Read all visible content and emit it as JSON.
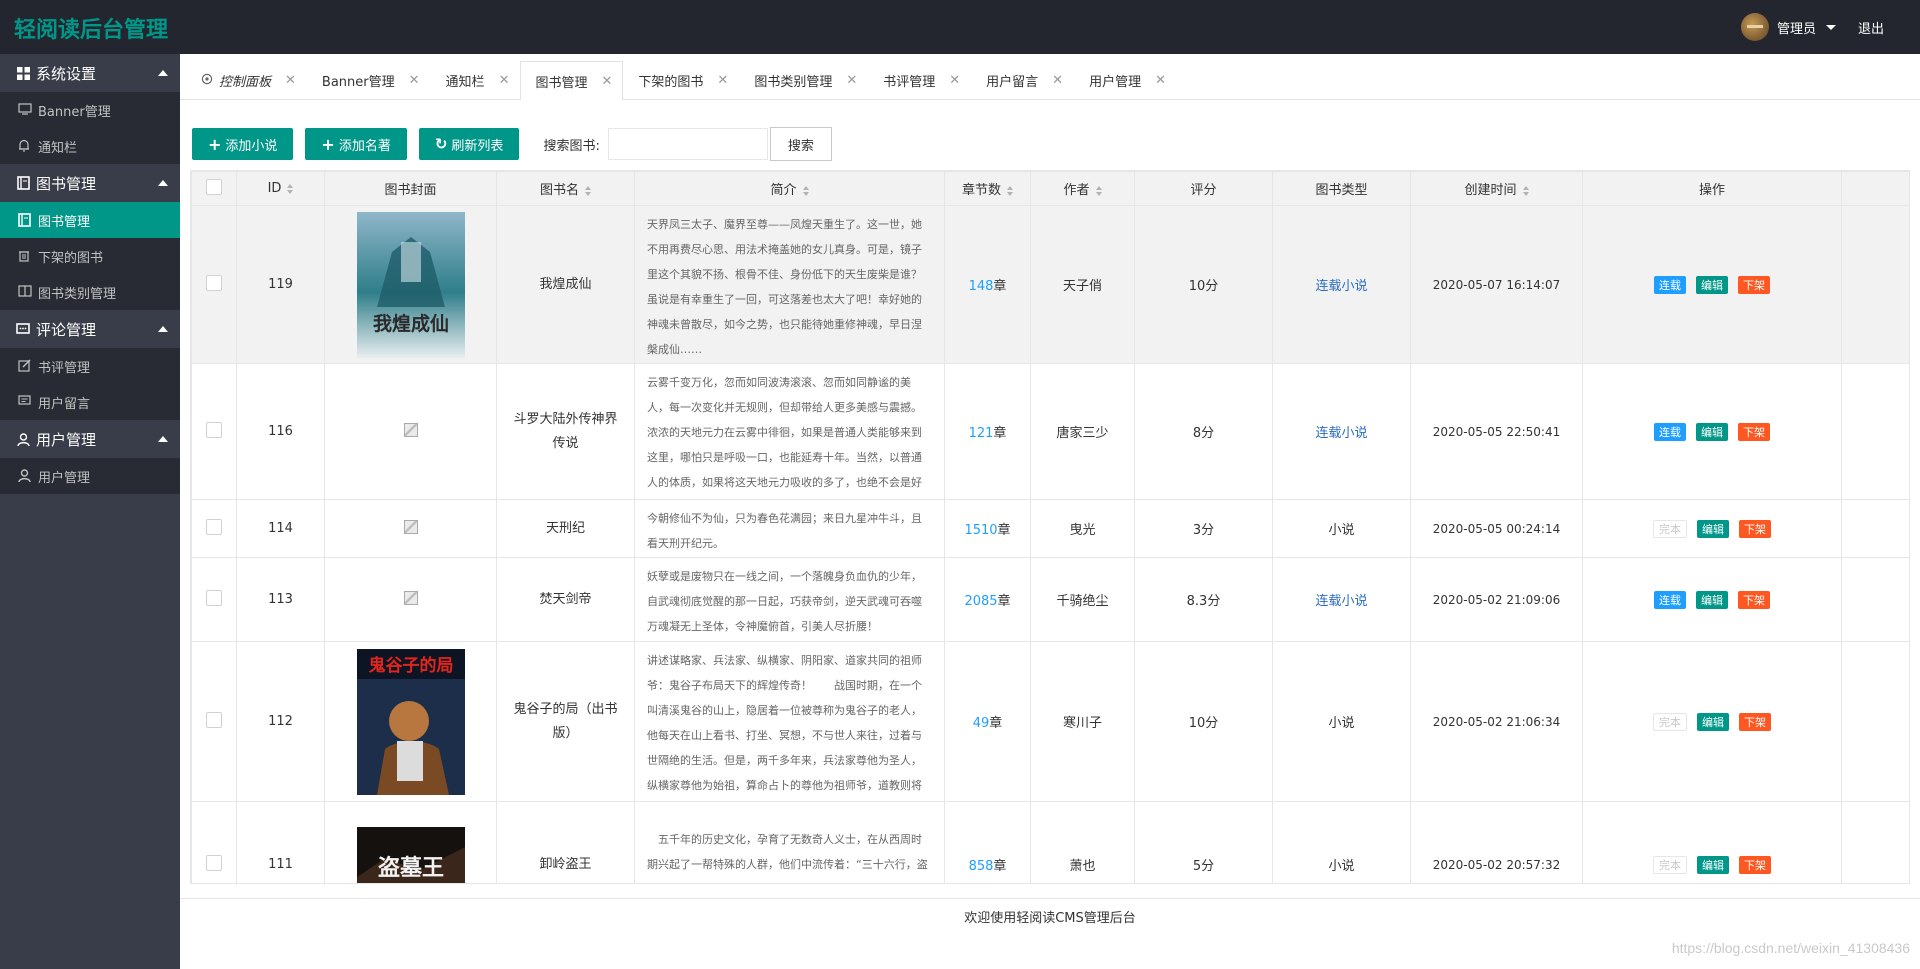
{
  "header": {
    "logo": "轻阅读后台管理",
    "user": "管理员",
    "logout": "退出"
  },
  "sidebar": [
    {
      "title": "系统设置",
      "icon": "grid-icon",
      "items": [
        {
          "label": "Banner管理",
          "icon": "monitor-icon"
        },
        {
          "label": "通知栏",
          "icon": "bell-icon"
        }
      ]
    },
    {
      "title": "图书管理",
      "icon": "book-icon",
      "items": [
        {
          "label": "图书管理",
          "icon": "book-icon",
          "active": true
        },
        {
          "label": "下架的图书",
          "icon": "trash-icon"
        },
        {
          "label": "图书类别管理",
          "icon": "open-book-icon"
        }
      ]
    },
    {
      "title": "评论管理",
      "icon": "comment-icon",
      "items": [
        {
          "label": "书评管理",
          "icon": "edit-icon"
        },
        {
          "label": "用户留言",
          "icon": "message-icon"
        }
      ]
    },
    {
      "title": "用户管理",
      "icon": "user-icon",
      "items": [
        {
          "label": "用户管理",
          "icon": "user-icon"
        }
      ]
    }
  ],
  "tabs": [
    {
      "label": "控制面板",
      "home": true
    },
    {
      "label": "Banner管理"
    },
    {
      "label": "通知栏"
    },
    {
      "label": "图书管理",
      "active": true
    },
    {
      "label": "下架的图书"
    },
    {
      "label": "图书类别管理"
    },
    {
      "label": "书评管理"
    },
    {
      "label": "用户留言"
    },
    {
      "label": "用户管理"
    }
  ],
  "toolbar": {
    "add_novel": "添加小说",
    "add_classic": "添加名著",
    "refresh": "刷新列表",
    "search_label": "搜索图书:",
    "search_value": "",
    "search_button": "搜索"
  },
  "table": {
    "columns": [
      "",
      "ID",
      "图书封面",
      "图书名",
      "简介",
      "章节数",
      "作者",
      "评分",
      "图书类型",
      "创建时间",
      "操作"
    ],
    "rows": [
      {
        "id": "119",
        "cover": "image",
        "cover_title": "我煌成仙",
        "name": "我煌成仙",
        "desc": "天界凤三太子、魔界至尊——凤煌天重生了。这一世，她不用再费尽心思、用法术掩盖她的女儿真身。可是，镜子里这个其貌不扬、根骨不佳、身份低下的天生废柴是谁？虽说是有幸重生了一回，可这落差也太大了吧！幸好她的神魂未曾散尽，如今之势，也只能待她重修神魂，早日涅槃成仙……",
        "chapters": "148",
        "author": "天子俏",
        "score": "10分",
        "type": "连载小说",
        "type_link": true,
        "time": "2020-05-07 16:14:07",
        "status": "连载"
      },
      {
        "id": "116",
        "cover": "broken",
        "name": "斗罗大陆外传神界传说",
        "desc": "云雾千变万化，忽而如同波涛滚滚、忽而如同静谧的美人，每一次变化并无规则，但却带给人更多美感与震撼。浓浓的天地元力在云雾中徘徊，如果是普通人类能够来到这里，哪怕只是呼吸一口，也能延寿十年。当然，以普通人的体质，如果将这天地元力吸收的多了，也绝不会是好事。",
        "chapters": "121",
        "author": "唐家三少",
        "score": "8分",
        "type": "连载小说",
        "type_link": true,
        "time": "2020-05-05 22:50:41",
        "status": "连载"
      },
      {
        "id": "114",
        "cover": "broken",
        "name": "天刑纪",
        "desc": "今朝修仙不为仙，只为春色花满园；来日九星冲牛斗，且看天刑开纪元。",
        "chapters": "1510",
        "author": "曳光",
        "score": "3分",
        "type": "小说",
        "type_link": false,
        "time": "2020-05-05 00:24:14",
        "status": "完本"
      },
      {
        "id": "113",
        "cover": "broken",
        "name": "焚天剑帝",
        "desc": "妖孽或是废物只在一线之间，一个落魄身负血仇的少年，自武魂彻底觉醒的那一日起，巧获帝剑，逆天武魂可吞噬万魂凝无上圣体，令神魔俯首，引美人尽折腰！",
        "chapters": "2085",
        "author": "千骑绝尘",
        "score": "8.3分",
        "type": "连载小说",
        "type_link": true,
        "time": "2020-05-02 21:09:06",
        "status": "连载"
      },
      {
        "id": "112",
        "cover": "image",
        "cover_title": "鬼谷子的局",
        "name": "鬼谷子的局（出书版）",
        "desc": "讲述谋略家、兵法家、纵横家、阴阳家、道家共同的祖师爷：鬼谷子布局天下的辉煌传奇！　　战国时期，在一个叫清溪鬼谷的山上，隐居着一位被尊称为鬼谷子的老人，他每天在山上看书、打坐、冥想，不与世人来往，过着与世隔绝的生活。但是，两千多年来，兵法家尊他为圣人，纵横家尊他为始祖，算命占卜的尊他为祖师爷，道教则将他与老…",
        "chapters": "49",
        "author": "寒川子",
        "score": "10分",
        "type": "小说",
        "type_link": false,
        "time": "2020-05-02 21:06:34",
        "status": "完本"
      },
      {
        "id": "111",
        "cover": "image",
        "cover_title": "盗墓王",
        "name": "卸岭盗王",
        "desc": "　五千年的历史文化，孕育了无数奇人义士，在从西周时期兴起了一帮特殊的人群，他们中流传着：“三十六行，盗墓为王”。　　倒卖古董的“我”，迁移祖坟之时获得祖上残",
        "chapters": "858",
        "author": "萧也",
        "score": "5分",
        "type": "小说",
        "type_link": false,
        "time": "2020-05-02 20:57:32",
        "status": "完本"
      }
    ],
    "chapter_unit": "章",
    "op_edit": "编辑",
    "op_down": "下架"
  },
  "footer": "欢迎使用轻阅读CMS管理后台",
  "watermark": "https://blog.csdn.net/weixin_41308436",
  "colors": {
    "accent": "#009688",
    "header": "#23262e",
    "sidebar": "#393d49",
    "blue": "#1e9fff",
    "orange": "#ff5722"
  }
}
